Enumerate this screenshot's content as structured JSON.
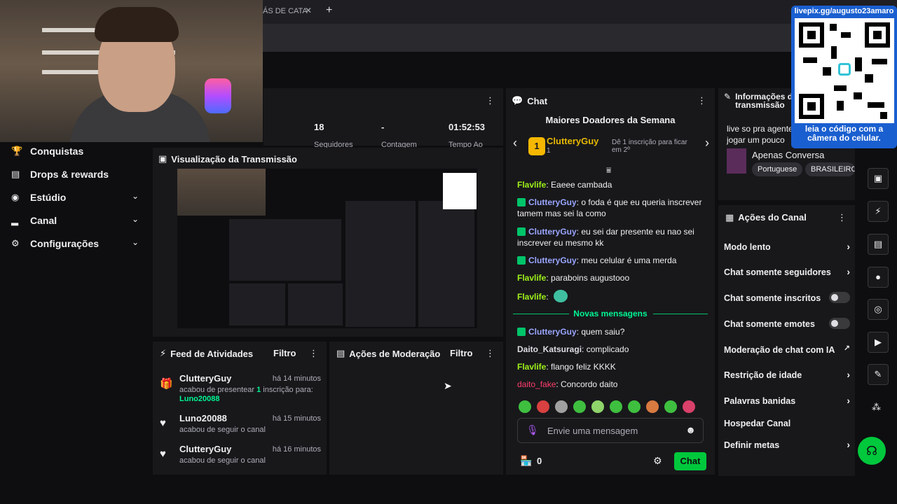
{
  "browser": {
    "tab_title": "ÁS DE CATA",
    "tab_close": "✕",
    "new_tab": "+"
  },
  "sidebar": {
    "items": [
      {
        "label": "Conquistas",
        "icon": "trophy-icon"
      },
      {
        "label": "Drops & rewards",
        "icon": "drops-icon"
      },
      {
        "label": "Estúdio",
        "icon": "studio-icon"
      },
      {
        "label": "Canal",
        "icon": "channel-icon"
      },
      {
        "label": "Configurações",
        "icon": "gear-icon"
      }
    ]
  },
  "stats": {
    "values": [
      "18",
      "-",
      "01:52:53"
    ],
    "labels": [
      "Seguidores",
      "Contagem",
      "Tempo Ao"
    ]
  },
  "preview": {
    "title": "Visualização da Transmissão"
  },
  "feed": {
    "title": "Feed de Atividades",
    "filter": "Filtro",
    "items": [
      {
        "user": "ClutteryGuy",
        "time": "há 14 minutos",
        "desc_prefix": "acabou de presentear ",
        "desc_count": "1",
        "desc_suffix": " inscrição para:",
        "recipient": "Luno20088",
        "icon": "gift-icon"
      },
      {
        "user": "Luno20088",
        "time": "há 15 minutos",
        "desc": "acabou de seguir o canal",
        "icon": "heart-icon"
      },
      {
        "user": "ClutteryGuy",
        "time": "há 16 minutos",
        "desc": "acabou de seguir o canal",
        "icon": "heart-icon"
      }
    ]
  },
  "moderation": {
    "title": "Ações de Moderação",
    "filter": "Filtro"
  },
  "chat": {
    "title": "Chat",
    "donors_title": "Maiores Doadores da Semana",
    "donor": {
      "rank": "1",
      "name": "ClutteryGuy",
      "count": "1",
      "hint": "Dê 1 inscrição para ficar em 2º"
    },
    "messages": [
      {
        "user": "Flavlife",
        "text": ": Eaeee cambada",
        "color": "green"
      },
      {
        "user": "ClutteryGuy",
        "text": ": o foda é que eu queria inscrever tamem mas sei la como",
        "color": "blue",
        "badge": true
      },
      {
        "user": "ClutteryGuy",
        "text": ": eu sei dar presente eu nao sei inscrever eu mesmo kk",
        "color": "blue",
        "badge": true
      },
      {
        "user": "ClutteryGuy",
        "text": ": meu celular é uma merda",
        "color": "blue",
        "badge": true
      },
      {
        "user": "Flavlife",
        "text": ": paraboins augustooo",
        "color": "green"
      },
      {
        "user": "Flavlife",
        "text": ":",
        "color": "green"
      }
    ],
    "new_messages_label": "Novas mensagens",
    "new_messages": [
      {
        "user": "ClutteryGuy",
        "text": ": quem saiu?",
        "color": "blue",
        "badge": true
      },
      {
        "user": "Daito_Katsuragi",
        "text": ": complicado",
        "color": "white"
      },
      {
        "user": "Flavlife",
        "text": ": flango feliz KKKK",
        "color": "green"
      },
      {
        "user": "daito_fake",
        "text": ": Concordo daito",
        "color": "red"
      }
    ],
    "input_placeholder": "Envie uma mensagem",
    "points": "0",
    "send_label": "Chat"
  },
  "info": {
    "title": "Informações da transmissão",
    "stream_title": "live so pra agente jogar um pouco",
    "category": "Apenas Conversa",
    "tags": [
      "Portuguese",
      "BRASILEIRO"
    ]
  },
  "actions": {
    "title": "Ações do Canal",
    "items": [
      {
        "label": "Modo lento",
        "kind": "chevron"
      },
      {
        "label": "Chat somente seguidores",
        "kind": "chevron"
      },
      {
        "label": "Chat somente inscritos",
        "kind": "toggle"
      },
      {
        "label": "Chat somente emotes",
        "kind": "toggle"
      },
      {
        "label": "Moderação de chat com IA",
        "kind": "external"
      },
      {
        "label": "Restrição de idade",
        "kind": "chevron"
      },
      {
        "label": "Palavras banidas",
        "kind": "chevron"
      },
      {
        "label": "Hospedar Canal",
        "kind": "none"
      },
      {
        "label": "Definir metas",
        "kind": "chevron"
      }
    ]
  },
  "qr": {
    "url": "livepix.gg/augusto23amaro",
    "caption": "leia o código com a câmera do celular."
  },
  "colors": {
    "accent_green": "#00c83c",
    "brand_blue": "#1a5fd0",
    "donor_gold": "#f5b700"
  }
}
